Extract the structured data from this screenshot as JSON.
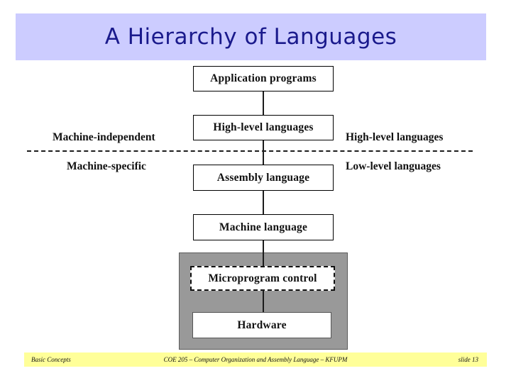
{
  "slide": {
    "title": "A Hierarchy of Languages",
    "title_bg_color": "#ccccff",
    "title_text_color": "#1a1a8c",
    "background_color": "#ffffff"
  },
  "diagram": {
    "type": "layered-hierarchy",
    "boxes": [
      {
        "id": "application",
        "label": "Application programs",
        "style": "solid"
      },
      {
        "id": "highlevel",
        "label": "High-level languages",
        "style": "solid"
      },
      {
        "id": "assembly",
        "label": "Assembly language",
        "style": "solid"
      },
      {
        "id": "machine",
        "label": "Machine language",
        "style": "solid"
      },
      {
        "id": "microprogram",
        "label": "Microprogram control",
        "style": "dashed"
      },
      {
        "id": "hardware",
        "label": "Hardware",
        "style": "solid"
      }
    ],
    "left_labels": [
      {
        "id": "machine-independent",
        "label": "Machine-independent"
      },
      {
        "id": "machine-specific",
        "label": "Machine-specific"
      }
    ],
    "right_labels": [
      {
        "id": "high-level-languages",
        "label": "High-level languages"
      },
      {
        "id": "low-level-languages",
        "label": "Low-level languages"
      }
    ],
    "divider": {
      "style": "dashed",
      "color": "#1c1c1c"
    },
    "container": {
      "id": "hardware-group",
      "fill_color": "#999999"
    }
  },
  "footer": {
    "left": "Basic Concepts",
    "center": "COE 205 – Computer Organization and Assembly Language – KFUPM",
    "right": "slide 13",
    "bg_color": "#ffff99"
  }
}
